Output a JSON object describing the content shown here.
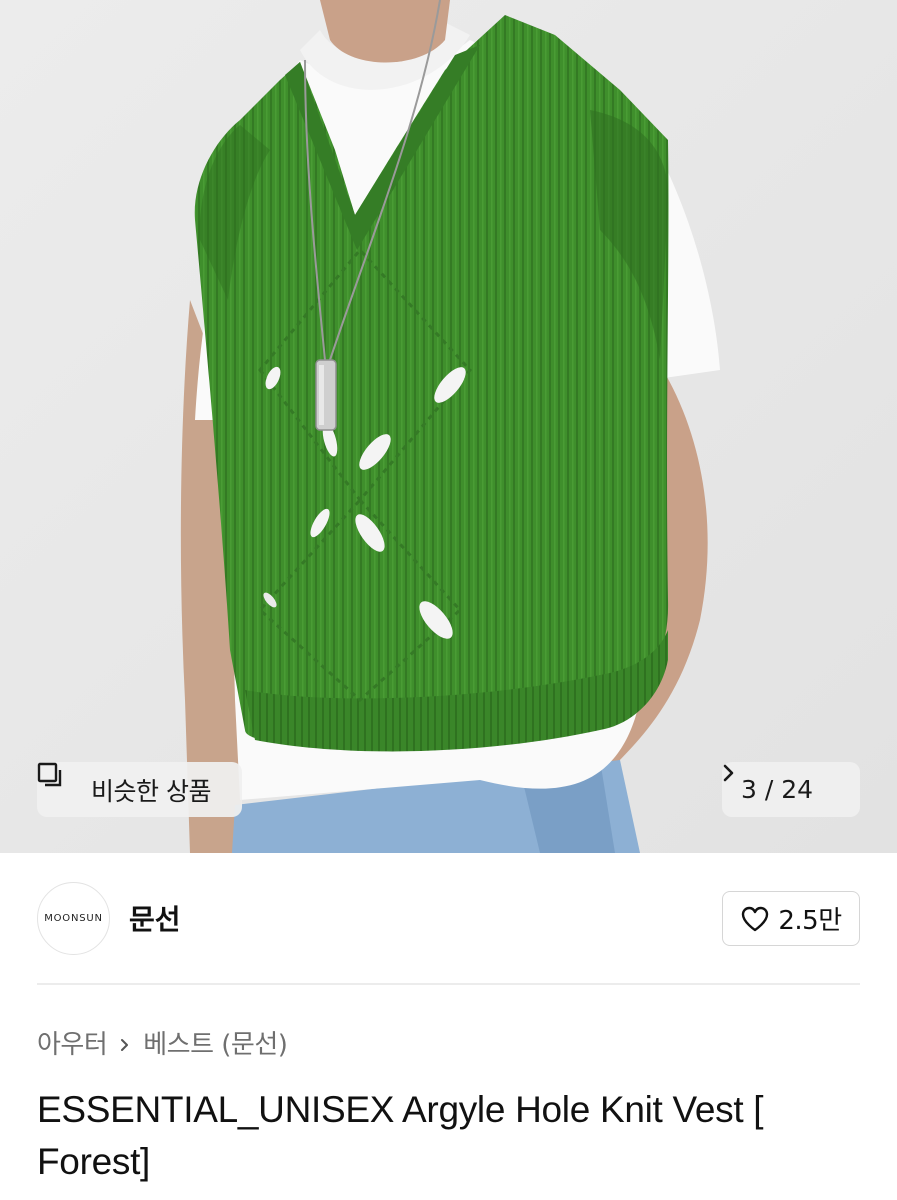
{
  "gallery": {
    "similar_label": "비슷한 상품",
    "current": "3",
    "total": "24",
    "pager_text": "3 / 24",
    "vest_color": "#3f8f2c"
  },
  "brand": {
    "logo_text": "MOONSUN",
    "name": "문선",
    "likes": "2.5만"
  },
  "breadcrumb": {
    "items": [
      "아우터",
      "베스트 (문선)"
    ]
  },
  "product": {
    "title": "ESSENTIAL_UNISEX Argyle Hole Knit Vest [ Forest]"
  }
}
